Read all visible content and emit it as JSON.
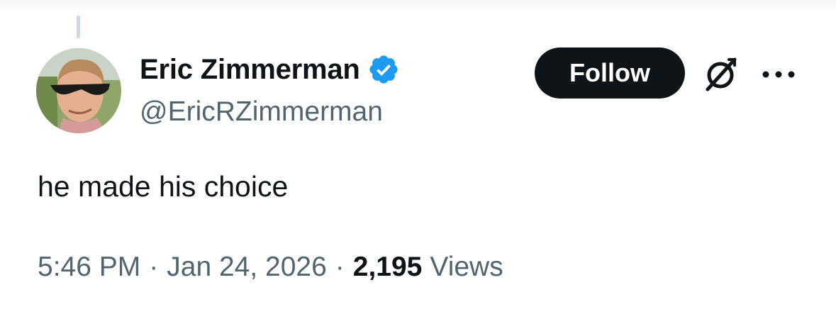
{
  "author": {
    "display_name": "Eric Zimmerman",
    "handle": "@EricRZimmerman",
    "verified": true,
    "verified_color": "#1d9bf0",
    "avatar_icon": "profile-photo"
  },
  "actions": {
    "follow_label": "Follow",
    "grok_icon": "grok-icon",
    "more_icon": "more-dots-icon"
  },
  "post": {
    "text": "he made his choice"
  },
  "meta": {
    "time": "5:46 PM",
    "separator": "·",
    "date": "Jan 24, 2026",
    "views_count": "2,195",
    "views_label": "Views"
  },
  "colors": {
    "text_primary": "#0f1419",
    "text_secondary": "#536471",
    "follow_bg": "#0f1419",
    "thread_line": "#cfd9de"
  }
}
